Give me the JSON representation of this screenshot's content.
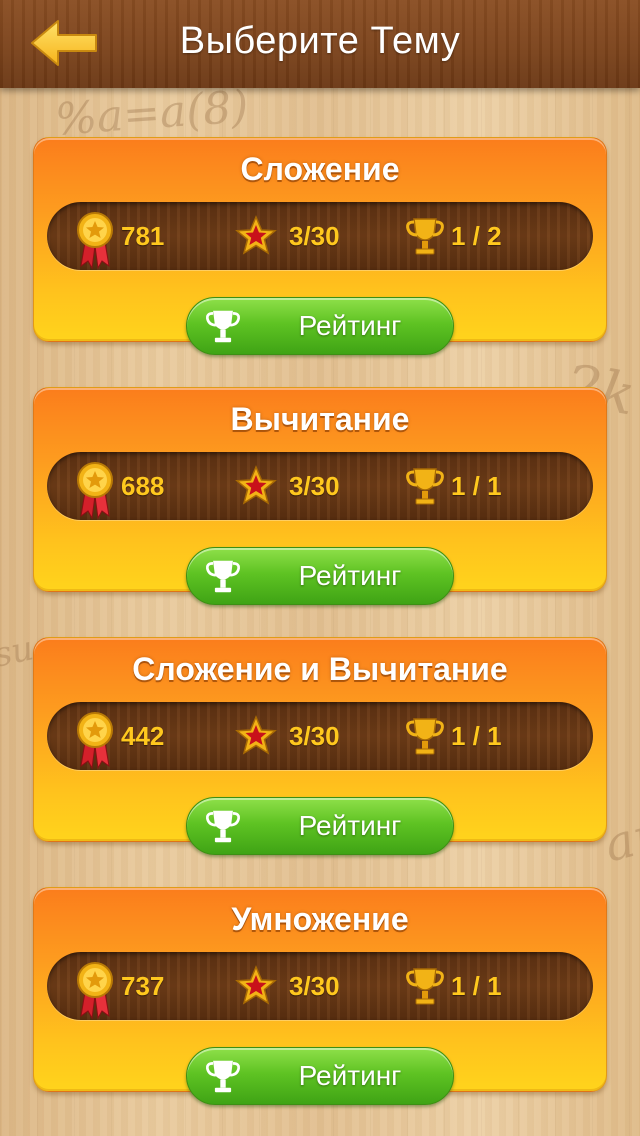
{
  "header": {
    "title": "Выберите Тему"
  },
  "topics": [
    {
      "name": "Сложение",
      "score": "781",
      "stars": "3/30",
      "rank": "1 / 2",
      "button_label": "Рейтинг"
    },
    {
      "name": "Вычитание",
      "score": "688",
      "stars": "3/30",
      "rank": "1 / 1",
      "button_label": "Рейтинг"
    },
    {
      "name": "Сложение и Вычитание",
      "score": "442",
      "stars": "3/30",
      "rank": "1 / 1",
      "button_label": "Рейтинг"
    },
    {
      "name": "Умножение",
      "score": "737",
      "stars": "3/30",
      "rank": "1 / 1",
      "button_label": "Рейтинг"
    }
  ],
  "icons": {
    "back": "back-arrow-icon",
    "score": "medal-icon",
    "stars": "star-icon",
    "rank": "trophy-icon",
    "rating_button": "trophy-icon"
  },
  "colors": {
    "accent_text": "#ffc81e",
    "card_top": "#fb7d1c",
    "card_bottom": "#ffd41c",
    "button_green": "#5fc323",
    "header_brown": "#7a421b"
  }
}
